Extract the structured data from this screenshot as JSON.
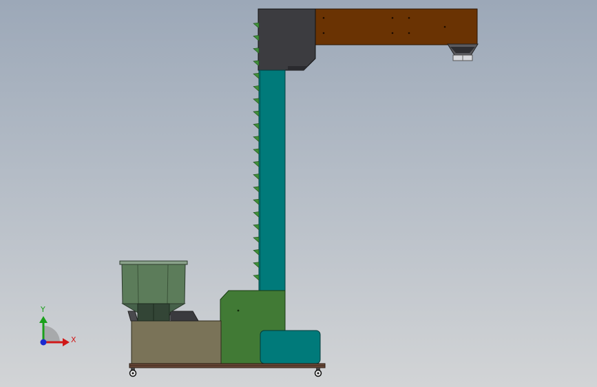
{
  "viewport": {
    "background_top": "#9ca8b8",
    "background_bottom": "#d2d4d6"
  },
  "triad": {
    "x_label": "X",
    "y_label": "Y",
    "x_color": "#d01818",
    "y_color": "#1aa01a",
    "z_color": "#1a2ad0"
  },
  "model": {
    "colors": {
      "head_housing": "#3c3c40",
      "top_conveyor": "#6a3303",
      "column": "#007a7a",
      "buckets": "#3f8f3a",
      "lower_housing": "#417a35",
      "motor_box": "#007a7a",
      "feeder_base": "#7a7358",
      "hopper": "#5c7c5a",
      "frame": "#6b4a3a"
    },
    "icons": [
      "bucket-icon",
      "caster-wheel-icon",
      "coordinate-triad-icon"
    ]
  }
}
